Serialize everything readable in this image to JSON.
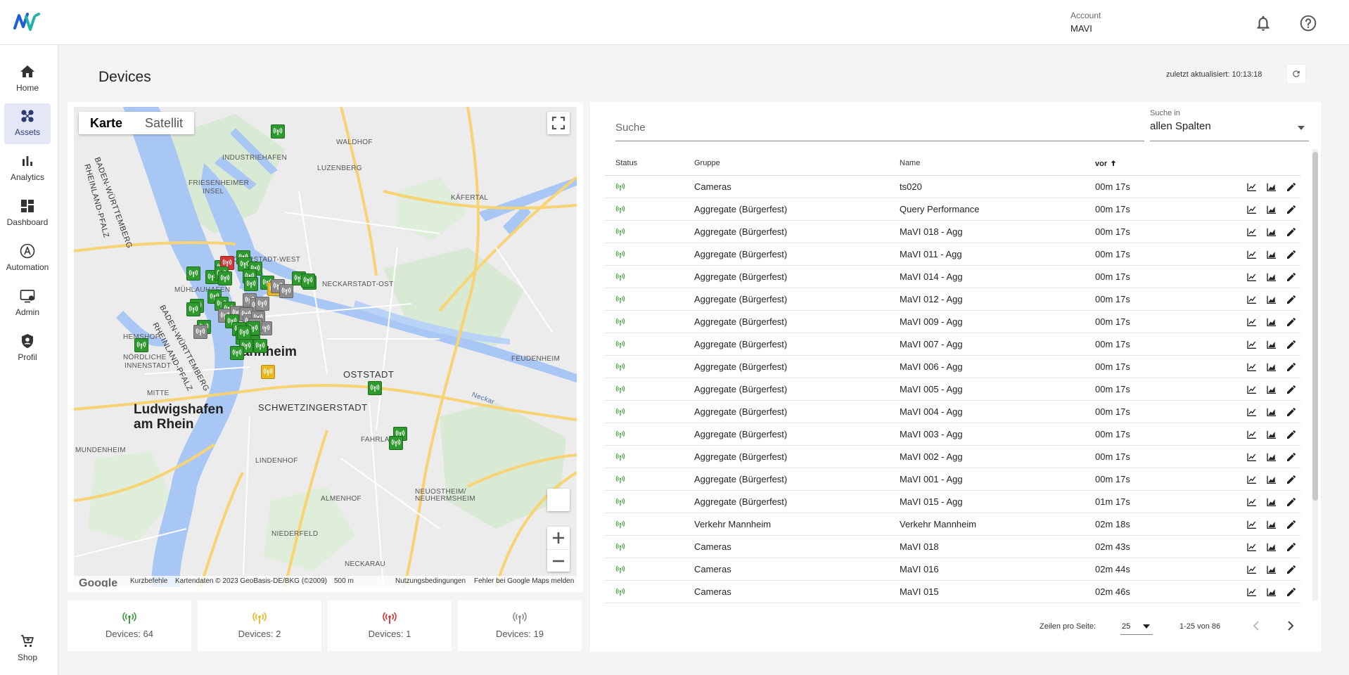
{
  "header": {
    "account_label": "Account",
    "account_value": "MAVI"
  },
  "sidebar": {
    "items": [
      {
        "label": "Home",
        "icon": "home-icon"
      },
      {
        "label": "Assets",
        "icon": "assets-icon",
        "active": true
      },
      {
        "label": "Analytics",
        "icon": "analytics-icon"
      },
      {
        "label": "Dashboard",
        "icon": "dashboard-icon"
      },
      {
        "label": "Automation",
        "icon": "automation-icon"
      },
      {
        "label": "Admin",
        "icon": "admin-icon"
      },
      {
        "label": "Profil",
        "icon": "profil-icon"
      }
    ],
    "shop_label": "Shop"
  },
  "page": {
    "title": "Devices",
    "updated": "zuletzt aktualisiert: 10:13:18"
  },
  "map": {
    "type_buttons": [
      "Karte",
      "Satellit"
    ],
    "place_labels": {
      "industriehafen": "INDUSTRIEHAFEN",
      "waldhof": "WALDHOF",
      "luzenberg": "LUZENBERG",
      "friesenheimer": "FRIESENHEIMER",
      "insel": "INSEL",
      "kafertal": "KÄFERTAL",
      "neckarstadt_west": "NECKARSTADT-WEST",
      "neckarstadt_ost": "NECKARSTADT-OST",
      "muhlauhafen": "MÜHLAUHAFEN",
      "hemshof": "HEMSHOF",
      "nordliche": "NÖRDLICHE",
      "innenstadt": "INNENSTADT",
      "mannheim": "Mannheim",
      "oststadt": "OSTSTADT",
      "feudenheim": "FEUDENHEIM",
      "mitte": "MITTE",
      "ludwigshafen_1": "Ludwigshafen",
      "ludwigshafen_2": "am Rhein",
      "schwetzingerstadt": "SCHWETZINGERSTADT",
      "fahrlach": "FAHRLACH",
      "lindenhof": "LINDENHOF",
      "almenhof": "ALMENHOF",
      "neuostheim_1": "NEUOSTHEIM/",
      "neuostheim_2": "NEUHERMSHEIM",
      "niederfeld": "NIEDERFELD",
      "neckarau": "NECKARAU",
      "mundenheim": "MUNDENHEIM",
      "bw_1": "BADEN-WÜRTTEMBERG",
      "rp_1": "RHEINLAND-PFALZ",
      "neckar": "Neckar"
    },
    "footer": {
      "google": "Google",
      "shortcuts": "Kurzbefehle",
      "mapdata": "Kartendaten © 2023 GeoBasis-DE/BKG (©2009)",
      "scale": "500 m",
      "terms": "Nutzungsbedingungen",
      "report": "Fehler bei Google Maps melden"
    }
  },
  "tiles": [
    {
      "label": "Devices: 64",
      "color": "#3a9a3a"
    },
    {
      "label": "Devices: 2",
      "color": "#e9b820"
    },
    {
      "label": "Devices: 1",
      "color": "#d33434"
    },
    {
      "label": "Devices: 19",
      "color": "#8d8d8d"
    }
  ],
  "table": {
    "search_placeholder": "Suche",
    "search_in_label": "Suche in",
    "search_in_value": "allen Spalten",
    "columns": {
      "status": "Status",
      "group": "Gruppe",
      "name": "Name",
      "since": "vor"
    },
    "rows": [
      {
        "group": "Cameras",
        "name": "ts020",
        "since": "00m 17s"
      },
      {
        "group": "Aggregate (Bürgerfest)",
        "name": "Query Performance",
        "since": "00m 17s"
      },
      {
        "group": "Aggregate (Bürgerfest)",
        "name": "MaVI 018 - Agg",
        "since": "00m 17s"
      },
      {
        "group": "Aggregate (Bürgerfest)",
        "name": "MaVI 011 - Agg",
        "since": "00m 17s"
      },
      {
        "group": "Aggregate (Bürgerfest)",
        "name": "MaVI 014 - Agg",
        "since": "00m 17s"
      },
      {
        "group": "Aggregate (Bürgerfest)",
        "name": "MaVI 012 - Agg",
        "since": "00m 17s"
      },
      {
        "group": "Aggregate (Bürgerfest)",
        "name": "MaVI 009 - Agg",
        "since": "00m 17s"
      },
      {
        "group": "Aggregate (Bürgerfest)",
        "name": "MaVI 007 - Agg",
        "since": "00m 17s"
      },
      {
        "group": "Aggregate (Bürgerfest)",
        "name": "MaVI 006 - Agg",
        "since": "00m 17s"
      },
      {
        "group": "Aggregate (Bürgerfest)",
        "name": "MaVI 005 - Agg",
        "since": "00m 17s"
      },
      {
        "group": "Aggregate (Bürgerfest)",
        "name": "MaVI 004 - Agg",
        "since": "00m 17s"
      },
      {
        "group": "Aggregate (Bürgerfest)",
        "name": "MaVI 003 - Agg",
        "since": "00m 17s"
      },
      {
        "group": "Aggregate (Bürgerfest)",
        "name": "MaVI 002 - Agg",
        "since": "00m 17s"
      },
      {
        "group": "Aggregate (Bürgerfest)",
        "name": "MaVI 001 - Agg",
        "since": "00m 17s"
      },
      {
        "group": "Aggregate (Bürgerfest)",
        "name": "MaVI 015 - Agg",
        "since": "01m 17s"
      },
      {
        "group": "Verkehr Mannheim",
        "name": "Verkehr Mannheim",
        "since": "02m 18s"
      },
      {
        "group": "Cameras",
        "name": "MaVI 018",
        "since": "02m 43s"
      },
      {
        "group": "Cameras",
        "name": "MaVI 016",
        "since": "02m 44s"
      },
      {
        "group": "Cameras",
        "name": "MaVI 015",
        "since": "02m 46s"
      }
    ],
    "pagination": {
      "rows_per_page_label": "Zeilen pro Seite:",
      "rows_per_page": "25",
      "range": "1-25 von 86"
    }
  },
  "colors": {
    "online": "#3a9a3a",
    "warning": "#e9b820",
    "error": "#d33434",
    "offline": "#8d8d8d",
    "accent": "#2c3a74"
  }
}
